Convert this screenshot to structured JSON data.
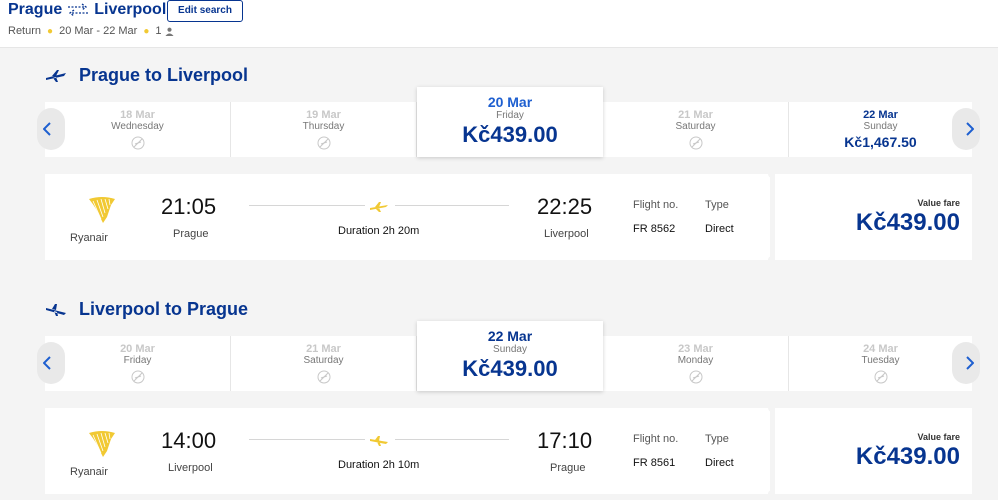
{
  "header": {
    "origin": "Prague",
    "destination": "Liverpool",
    "edit_label": "Edit search",
    "trip_type": "Return",
    "dates": "20 Mar - 22 Mar",
    "passengers": "1"
  },
  "outbound": {
    "title": "Prague to Liverpool",
    "dates": [
      {
        "date": "18 Mar",
        "weekday": "Wednesday",
        "available": false
      },
      {
        "date": "19 Mar",
        "weekday": "Thursday",
        "available": false
      },
      {
        "date": "20 Mar",
        "weekday": "Friday",
        "price": "Kč439.00",
        "selected": true
      },
      {
        "date": "21 Mar",
        "weekday": "Saturday",
        "available": false
      },
      {
        "date": "22 Mar",
        "weekday": "Sunday",
        "price": "Kč1,467.50",
        "available": true
      }
    ],
    "flight": {
      "airline": "Ryanair",
      "depart_time": "21:05",
      "depart_city": "Prague",
      "duration": "Duration 2h 20m",
      "arrive_time": "22:25",
      "arrive_city": "Liverpool",
      "flight_no_label": "Flight no.",
      "flight_no": "FR 8562",
      "type_label": "Type",
      "type": "Direct",
      "fare_label": "Value fare",
      "fare": "Kč439.00"
    }
  },
  "inbound": {
    "title": "Liverpool to Prague",
    "dates": [
      {
        "date": "20 Mar",
        "weekday": "Friday",
        "available": false
      },
      {
        "date": "21 Mar",
        "weekday": "Saturday",
        "available": false
      },
      {
        "date": "22 Mar",
        "weekday": "Sunday",
        "price": "Kč439.00",
        "selected": true
      },
      {
        "date": "23 Mar",
        "weekday": "Monday",
        "available": false
      },
      {
        "date": "24 Mar",
        "weekday": "Tuesday",
        "available": false
      }
    ],
    "flight": {
      "airline": "Ryanair",
      "depart_time": "14:00",
      "depart_city": "Liverpool",
      "duration": "Duration 2h 10m",
      "arrive_time": "17:10",
      "arrive_city": "Prague",
      "flight_no_label": "Flight no.",
      "flight_no": "FR 8561",
      "type_label": "Type",
      "type": "Direct",
      "fare_label": "Value fare",
      "fare": "Kč439.00"
    }
  },
  "colors": {
    "brand": "#073590",
    "accent": "#f1c933",
    "selected_date": "#1e5fd0"
  },
  "icons": {
    "na": "no-flights-icon",
    "plane": "plane-icon",
    "logo": "ryanair-harp-icon"
  }
}
